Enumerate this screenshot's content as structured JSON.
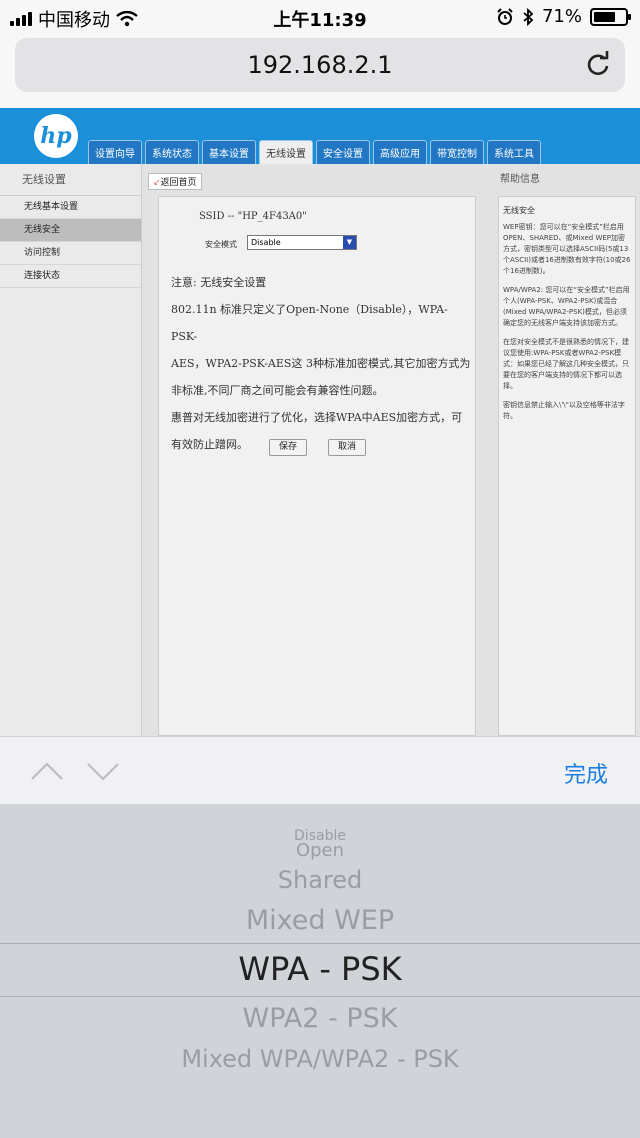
{
  "status_bar": {
    "carrier": "中国移动",
    "time": "上午11:39",
    "battery": "71%",
    "battery_level": 0.71
  },
  "browser": {
    "url": "192.168.2.1",
    "reload_icon": "reload-icon"
  },
  "header": {
    "logo": "hp",
    "tabs": [
      "设置向导",
      "系统状态",
      "基本设置",
      "无线设置",
      "安全设置",
      "高级应用",
      "带宽控制",
      "系统工具"
    ],
    "active_tab": "无线设置"
  },
  "sidebar": {
    "title": "无线设置",
    "items": [
      "无线基本设置",
      "无线安全",
      "访问控制",
      "连接状态"
    ],
    "active_item": "无线安全"
  },
  "main": {
    "back_label": "返回首页",
    "ssid": "SSID -- \"HP_4F43A0\"",
    "security_mode_label": "安全模式",
    "security_mode_value": "Disable",
    "notice_lines": [
      "注意:  无线安全设置",
      "802.11n 标准只定义了Open-None（Disable），WPA-PSK-",
      "AES，WPA2-PSK-AES这 3种标准加密模式,其它加密方式为",
      "非标准,不同厂商之间可能会有兼容性问题。",
      "惠普对无线加密进行了优化，选择WPA中AES加密方式，可",
      "有效防止蹭网。"
    ],
    "save_label": "保存",
    "cancel_label": "取消"
  },
  "help": {
    "title": "帮助信息",
    "heading": "无线安全",
    "paragraphs": [
      "WEP密钥：您可以在“安全模式”栏启用OPEN、SHARED、或Mixed WEP加密方式，密钥类型可以选择ASCII码(5或13个ASCII)或者16进制数有效字符(10或26个16进制数)。",
      "WPA/WPA2: 您可以在“安全模式”栏启用个人(WPA-PSK、WPA2-PSK)或混合(Mixed WPA/WPA2-PSK)模式，但必须确定您的无线客户端支持该加密方式。",
      "在您对安全模式不是很熟悉的情况下，建议您使用:WPA-PSK或者WPA2-PSK模式：如果您已经了解这几种安全模式，只要在您的客户端支持的情况下都可以选择。",
      "密钥信息禁止输入\\'\\\"以及空格等非法字符。"
    ]
  },
  "keyboard_bar": {
    "done_label": "完成"
  },
  "picker": {
    "options": [
      "Disable",
      "Open",
      "Shared",
      "Mixed WEP",
      "WPA - PSK",
      "WPA2 - PSK",
      "Mixed WPA/WPA2 - PSK"
    ],
    "selected": "WPA - PSK"
  }
}
